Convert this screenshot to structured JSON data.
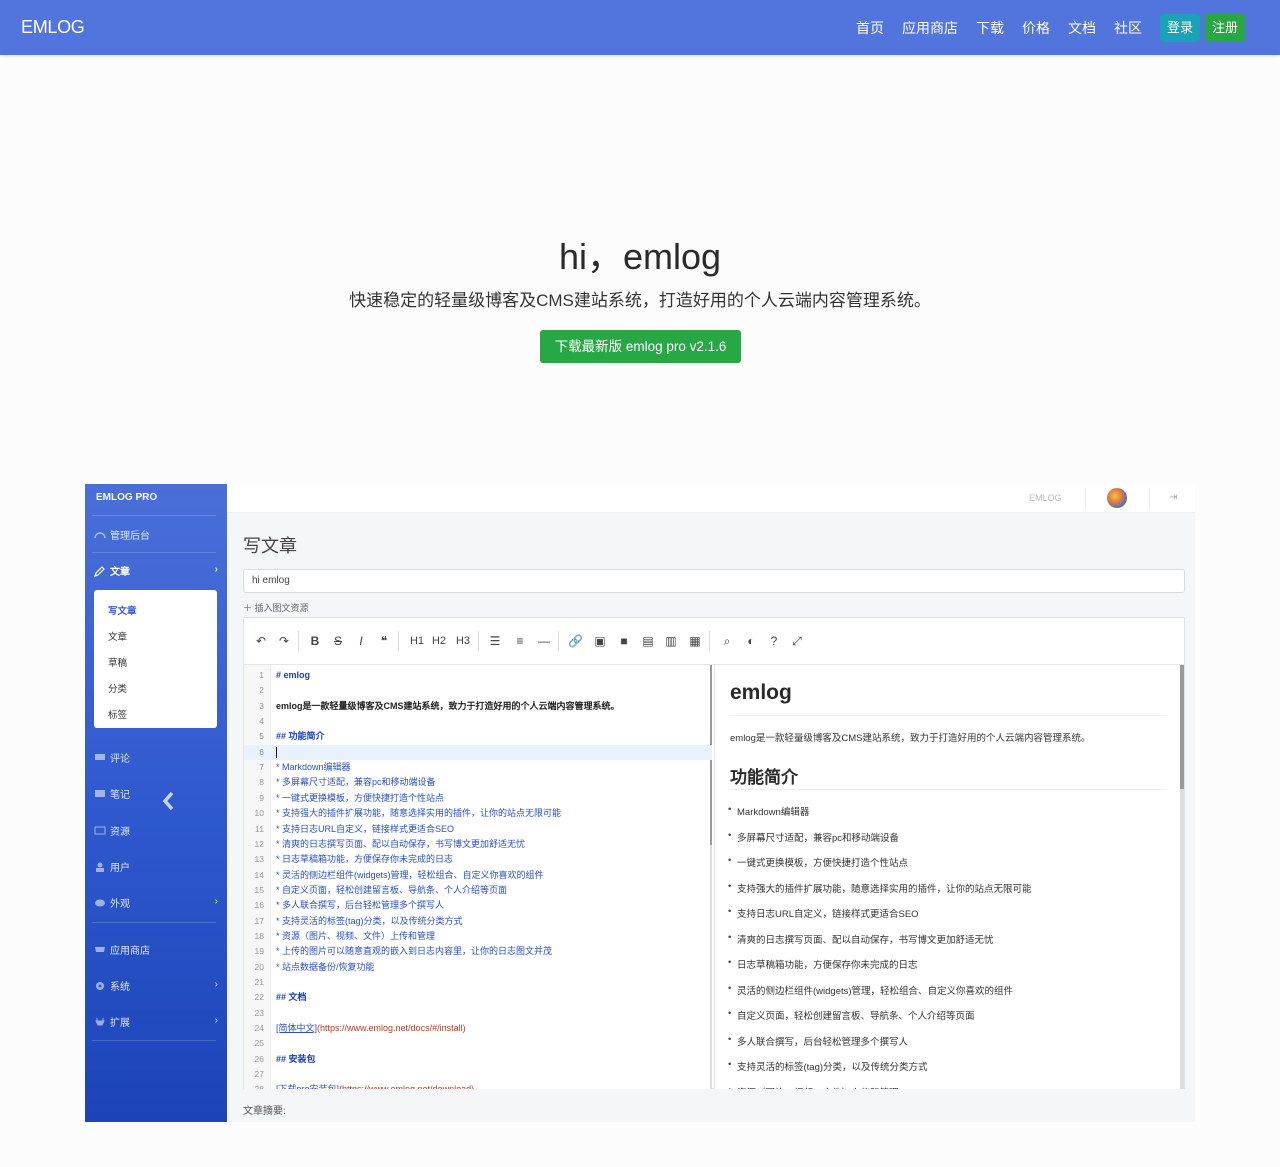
{
  "navbar": {
    "brand": "EMLOG",
    "links": [
      "首页",
      "应用商店",
      "下载",
      "价格",
      "文档",
      "社区"
    ],
    "login": "登录",
    "register": "注册"
  },
  "hero": {
    "title": "hi，emlog",
    "subtitle": "快速稳定的轻量级博客及CMS建站系统，打造好用的个人云端内容管理系统。",
    "download_button": "下载最新版 emlog pro v2.1.6"
  },
  "admin": {
    "sidebar": {
      "brand": "EMLOG PRO",
      "items": [
        {
          "label": "管理后台",
          "icon": "dashboard-icon",
          "chevron": false
        },
        {
          "label": "文章",
          "icon": "pencil-icon",
          "chevron": true
        },
        {
          "label": "评论",
          "icon": "comment-icon",
          "chevron": false
        },
        {
          "label": "笔记",
          "icon": "note-icon",
          "chevron": false
        },
        {
          "label": "资源",
          "icon": "image-icon",
          "chevron": false
        },
        {
          "label": "用户",
          "icon": "user-icon",
          "chevron": false
        },
        {
          "label": "外观",
          "icon": "palette-icon",
          "chevron": true
        },
        {
          "label": "应用商店",
          "icon": "store-icon",
          "chevron": false
        },
        {
          "label": "系统",
          "icon": "gear-icon",
          "chevron": true
        },
        {
          "label": "扩展",
          "icon": "plug-icon",
          "chevron": true
        }
      ],
      "submenu": [
        "写文章",
        "文章",
        "草稿",
        "分类",
        "标签"
      ],
      "chevron_glyph": "›",
      "collapse_icon": "chevron-left-icon"
    },
    "topbar": {
      "brand": "EMLOG",
      "logout_glyph": "⇥"
    },
    "page_title": "写文章",
    "title_input_value": "hi emlog",
    "insert_resource": "＋ 插入图文资源",
    "toolbar_tools": [
      "↶",
      "↷",
      "B",
      "S",
      "I",
      "❝",
      "H1",
      "H2",
      "H3",
      "☰",
      "≡",
      "—",
      "🔗",
      "▣",
      "■",
      "▤",
      "▥",
      "▦",
      "⌕",
      "◐",
      "?",
      "⤢"
    ],
    "code_lines": [
      {
        "n": "1",
        "text": "# emlog",
        "style": "head"
      },
      {
        "n": "2",
        "text": "",
        "style": "plain"
      },
      {
        "n": "3",
        "text": "emlog是一款轻量级博客及CMS建站系统，致力于打造好用的个人云端内容管理系统。",
        "style": "plain"
      },
      {
        "n": "4",
        "text": "",
        "style": "plain"
      },
      {
        "n": "5",
        "text": "## 功能简介",
        "style": "head"
      },
      {
        "n": "6",
        "text": "",
        "style": "plain"
      },
      {
        "n": "7",
        "text": "* Markdown编辑器",
        "style": "list"
      },
      {
        "n": "8",
        "text": "* 多屏幕尺寸适配，兼容pc和移动端设备",
        "style": "list"
      },
      {
        "n": "9",
        "text": "* 一键式更换模板，方便快捷打造个性站点",
        "style": "list"
      },
      {
        "n": "10",
        "text": "* 支持强大的插件扩展功能，随意选择实用的插件，让你的站点无限可能",
        "style": "list"
      },
      {
        "n": "11",
        "text": "* 支持日志URL自定义，链接样式更适合SEO",
        "style": "list"
      },
      {
        "n": "12",
        "text": "* 清爽的日志撰写页面、配以自动保存，书写博文更加舒适无忧",
        "style": "list"
      },
      {
        "n": "13",
        "text": "* 日志草稿箱功能，方便保存你未完成的日志",
        "style": "list"
      },
      {
        "n": "14",
        "text": "* 灵活的侧边栏组件(widgets)管理，轻松组合、自定义你喜欢的组件",
        "style": "list"
      },
      {
        "n": "15",
        "text": "* 自定义页面，轻松创建留言板、导航条、个人介绍等页面",
        "style": "list"
      },
      {
        "n": "16",
        "text": "* 多人联合撰写，后台轻松管理多个撰写人",
        "style": "list"
      },
      {
        "n": "17",
        "text": "* 支持灵活的标签(tag)分类，以及传统分类方式",
        "style": "list"
      },
      {
        "n": "18",
        "text": "* 资源（图片、视频、文件）上传和管理",
        "style": "list"
      },
      {
        "n": "19",
        "text": "* 上传的图片可以随意直观的嵌入到日志内容里，让你的日志图文并茂",
        "style": "list"
      },
      {
        "n": "20",
        "text": "* 站点数据备份/恢复功能",
        "style": "list"
      },
      {
        "n": "21",
        "text": "",
        "style": "plain"
      },
      {
        "n": "22",
        "text": "## 文档",
        "style": "head"
      },
      {
        "n": "23",
        "text": "",
        "style": "plain"
      },
      {
        "n": "24",
        "text": "[简体中文]",
        "url": "(https://www.emlog.net/docs/#/install)",
        "style": "link"
      },
      {
        "n": "25",
        "text": "",
        "style": "plain"
      },
      {
        "n": "26",
        "text": "## 安装包",
        "style": "head"
      },
      {
        "n": "27",
        "text": "",
        "style": "plain"
      },
      {
        "n": "28",
        "text": "[下载pro安装包]",
        "url": "(https://www.emlog.net/download)",
        "style": "link"
      }
    ],
    "preview": {
      "h1": "emlog",
      "paragraph": "emlog是一款轻量级博客及CMS建站系统，致力于打造好用的个人云端内容管理系统。",
      "h2": "功能简介",
      "items": [
        "Markdown编辑器",
        "多屏幕尺寸适配，兼容pc和移动端设备",
        "一键式更换模板，方便快捷打造个性站点",
        "支持强大的插件扩展功能，随意选择实用的插件，让你的站点无限可能",
        "支持日志URL自定义，链接样式更适合SEO",
        "清爽的日志撰写页面、配以自动保存，书写博文更加舒适无忧",
        "日志草稿箱功能，方便保存你未完成的日志",
        "灵活的侧边栏组件(widgets)管理，轻松组合、自定义你喜欢的组件",
        "自定义页面，轻松创建留言板、导航条、个人介绍等页面",
        "多人联合撰写，后台轻松管理多个撰写人",
        "支持灵活的标签(tag)分类，以及传统分类方式",
        "资源（图片、视频、文件）上传和管理"
      ]
    },
    "summary_label": "文章摘要:"
  }
}
